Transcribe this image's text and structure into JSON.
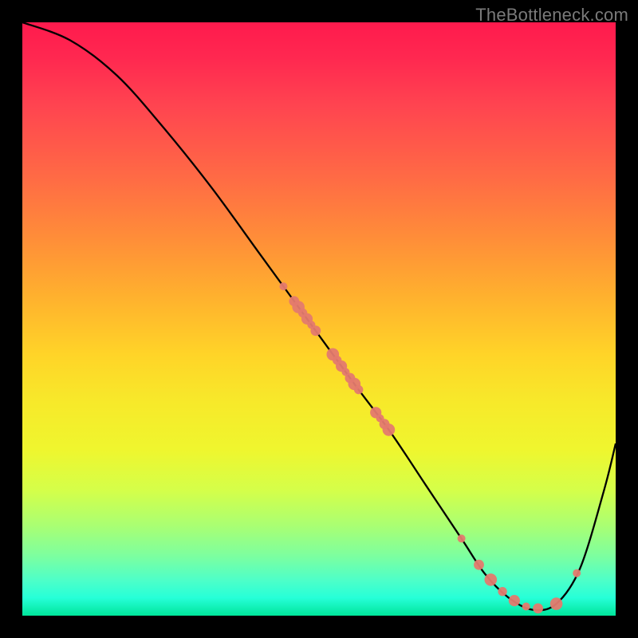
{
  "watermark": "TheBottleneck.com",
  "chart_data": {
    "type": "line",
    "title": "",
    "xlabel": "",
    "ylabel": "",
    "xlim": [
      0,
      100
    ],
    "ylim": [
      0,
      100
    ],
    "series": [
      {
        "name": "bottleneck-curve",
        "x": [
          0,
          8,
          16,
          24,
          32,
          40,
          48,
          56,
          62,
          68,
          74,
          78,
          82,
          86,
          90,
          94,
          98,
          100
        ],
        "y": [
          100,
          97,
          91,
          82,
          72,
          61,
          50,
          39,
          31,
          22,
          13,
          7,
          3,
          1,
          2,
          8,
          21,
          29
        ]
      }
    ],
    "marker_clusters": [
      {
        "name": "upper-scatter",
        "x_range": [
          44,
          62
        ],
        "count": 18
      },
      {
        "name": "valley-scatter",
        "x_range": [
          74,
          90
        ],
        "count": 8
      },
      {
        "name": "outlier",
        "x_range": [
          93,
          94
        ],
        "count": 1
      }
    ],
    "marker_color": "#e47a6e",
    "curve_color": "#000000"
  }
}
